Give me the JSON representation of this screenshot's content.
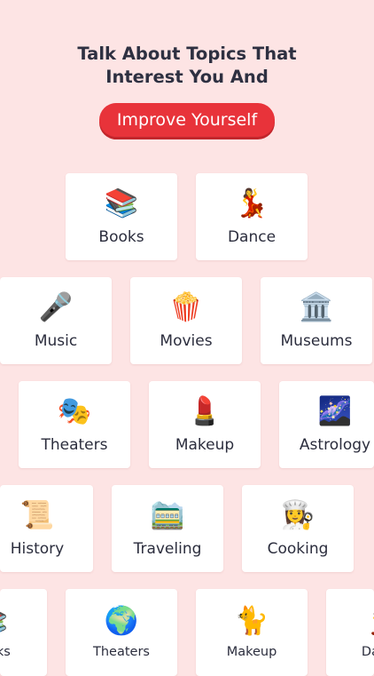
{
  "headline": {
    "line1": "Talk About Topics That",
    "line2": "Interest You And"
  },
  "cta": {
    "label": "Improve Yourself"
  },
  "rows": [
    [
      {
        "emoji": "📚",
        "label": "Books",
        "icon": "books-icon"
      },
      {
        "emoji": "💃",
        "label": "Dance",
        "icon": "dancer-icon"
      }
    ],
    [
      {
        "emoji": "🎤",
        "label": "Music",
        "icon": "microphone-icon"
      },
      {
        "emoji": "🍿",
        "label": "Movies",
        "icon": "popcorn-icon"
      },
      {
        "emoji": "🏛️",
        "label": "Museums",
        "icon": "museum-icon"
      }
    ],
    [
      {
        "emoji": "🎭",
        "label": "Theaters",
        "icon": "theater-masks-icon"
      },
      {
        "emoji": "💄",
        "label": "Makeup",
        "icon": "lipstick-icon"
      },
      {
        "emoji": "🌌",
        "label": "Astrology",
        "icon": "milky-way-icon"
      }
    ],
    [
      {
        "emoji": "📜",
        "label": "History",
        "icon": "scroll-icon"
      },
      {
        "emoji": "🚞",
        "label": "Traveling",
        "icon": "mountain-railway-icon"
      },
      {
        "emoji": "👩‍🍳",
        "label": "Cooking",
        "icon": "cook-icon"
      }
    ],
    [
      {
        "emoji": "📚",
        "label": "Books",
        "icon": "books-icon"
      },
      {
        "emoji": "🌍",
        "label": "Theaters",
        "icon": "globe-icon"
      },
      {
        "emoji": "🐈",
        "label": "Makeup",
        "icon": "cat-icon"
      },
      {
        "emoji": "💃",
        "label": "Dance",
        "icon": "dancer-icon"
      }
    ]
  ]
}
